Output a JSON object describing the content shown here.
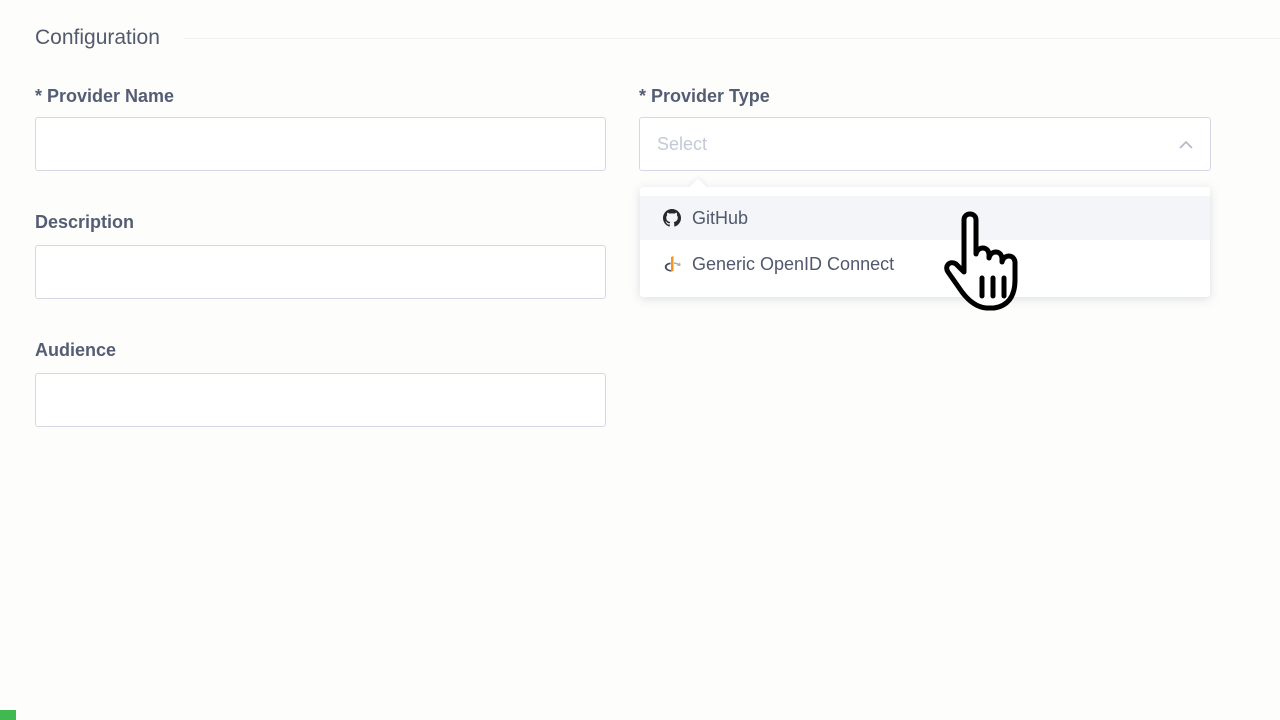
{
  "section": {
    "title": "Configuration"
  },
  "fields": {
    "provider_name": {
      "label": "* Provider Name",
      "value": ""
    },
    "description": {
      "label": "Description",
      "value": ""
    },
    "audience": {
      "label": "Audience",
      "value": ""
    },
    "provider_type": {
      "label": "* Provider Type",
      "placeholder": "Select"
    }
  },
  "dropdown": {
    "items": [
      {
        "label": "GitHub",
        "icon": "github-icon",
        "hovered": true
      },
      {
        "label": "Generic OpenID Connect",
        "icon": "openid-icon",
        "hovered": false
      }
    ]
  },
  "colors": {
    "background": "#fdfdfc",
    "border": "#d6d8e6",
    "text": "#555d74",
    "hover": "#f4f5f9",
    "openid_orange": "#f7931e",
    "accent_green": "#3fb950"
  }
}
